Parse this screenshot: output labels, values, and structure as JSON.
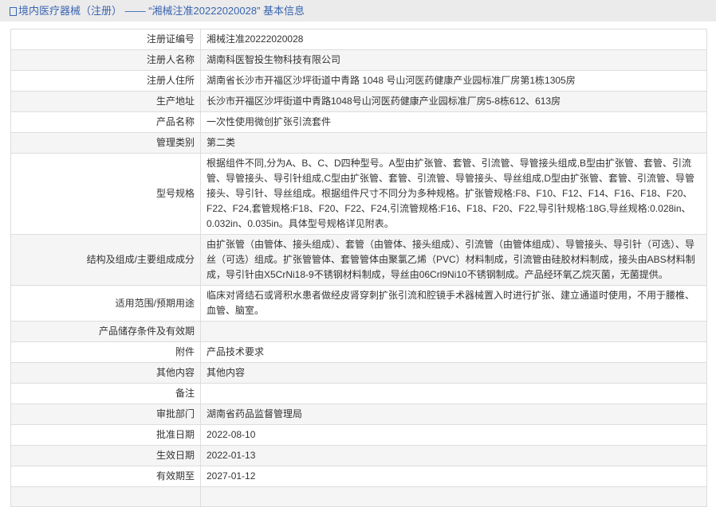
{
  "header": {
    "icon": "document-icon",
    "title": "境内医疗器械（注册）  ——  “湘械注准20222020028” 基本信息"
  },
  "rows": [
    {
      "label": "注册证编号",
      "value": "湘械注准20222020028"
    },
    {
      "label": "注册人名称",
      "value": "湖南科医智投生物科技有限公司"
    },
    {
      "label": "注册人住所",
      "value": "湖南省长沙市开福区沙坪街道中青路 1048 号山河医药健康产业园标准厂房第1栋1305房"
    },
    {
      "label": "生产地址",
      "value": "长沙市开福区沙坪街道中青路1048号山河医药健康产业园标准厂房5-8栋612、613房"
    },
    {
      "label": "产品名称",
      "value": "一次性使用微创扩张引流套件"
    },
    {
      "label": "管理类别",
      "value": "第二类"
    },
    {
      "label": "型号规格",
      "value": "根据组件不同,分为A、B、C、D四种型号。A型由扩张管、套管、引流管、导管接头组成,B型由扩张管、套管、引流管、导管接头、导引针组成,C型由扩张管、套管、引流管、导管接头、导丝组成,D型由扩张管、套管、引流管、导管接头、导引针、导丝组成。根据组件尺寸不同分为多种规格。扩张管规格:F8、F10、F12、F14、F16、F18、F20、F22、F24,套管规格:F18、F20、F22、F24,引流管规格:F16、F18、F20、F22,导引针规格:18G,导丝规格:0.028in、0.032in、0.035in。具体型号规格详见附表。"
    },
    {
      "label": "结构及组成/主要组成成分",
      "value": "由扩张管（由管体、接头组成）、套管（由管体、接头组成）、引流管（由管体组成）、导管接头、导引针（可选）、导丝（可选）组成。扩张管管体、套管管体由聚氯乙烯（PVC）材料制成，引流管由硅胶材料制成，接头由ABS材料制成，导引针由X5CrNi18-9不锈钢材料制成，导丝由06Crl9Ni10不锈钢制成。产品经环氧乙烷灭菌，无菌提供。"
    },
    {
      "label": "适用范围/预期用途",
      "value": "临床对肾结石或肾积水患者做经皮肾穿刺扩张引流和腔镜手术器械置入时进行扩张、建立通道时使用，不用于腰椎、血管、脑室。"
    },
    {
      "label": "产品储存条件及有效期",
      "value": ""
    },
    {
      "label": "附件",
      "value": "产品技术要求"
    },
    {
      "label": "其他内容",
      "value": "其他内容"
    },
    {
      "label": "备注",
      "value": ""
    },
    {
      "label": "审批部门",
      "value": "湖南省药品监督管理局"
    },
    {
      "label": "批准日期",
      "value": "2022-08-10"
    },
    {
      "label": "生效日期",
      "value": "2022-01-13"
    },
    {
      "label": "有效期至",
      "value": "2027-01-12"
    },
    {
      "label": "",
      "value": ""
    }
  ]
}
